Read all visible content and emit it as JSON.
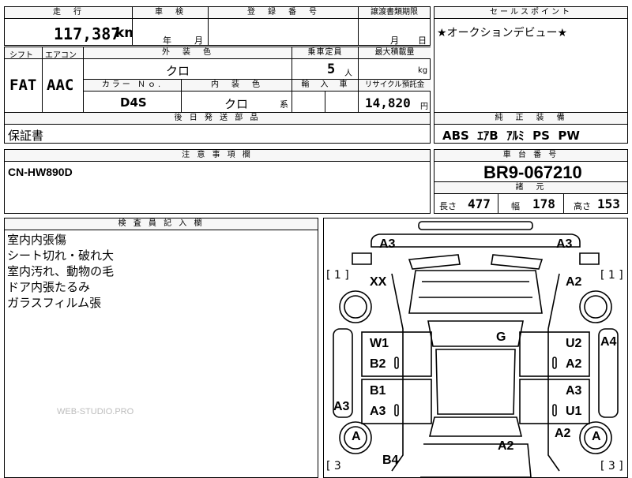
{
  "top": {
    "mileage_header": "走　行",
    "mileage_value": "117,387",
    "mileage_unit": "km",
    "inspection_header": "車　検",
    "inspection_year": "年",
    "inspection_month": "月",
    "registration_header": "登　録　番　号",
    "transfer_header": "譲渡書類期限",
    "transfer_month": "月",
    "transfer_day": "日",
    "selling_header": "セールスポイント",
    "selling_text": "★オークションデビュー★"
  },
  "specs": {
    "shift_header": "シフト",
    "shift_value": "FAT",
    "aircon_header": "エアコン",
    "aircon_value": "AAC",
    "exterior_header": "外　装　色",
    "exterior_value": "クロ",
    "color_no_header": "カラー Ｎｏ.",
    "color_no_value": "D4S",
    "interior_header": "内　装　色",
    "interior_value": "クロ",
    "interior_suffix": "系",
    "capacity_header": "乗車定員",
    "capacity_value": "5",
    "capacity_unit": "人",
    "load_header": "最大積載量",
    "load_unit": "kg",
    "import_header": "輸　入　車",
    "recycle_header": "リサイクル預託金",
    "recycle_value": "14,820",
    "recycle_unit": "円"
  },
  "equipment": {
    "header": "純　正　装　備",
    "value": "ABS  ｴｱB  ｱﾙﾐ  PS  PW"
  },
  "later_parts": {
    "header": "後 日 発 送 部 品",
    "value": "保証書"
  },
  "notes": {
    "header": "注 意 事 項 欄",
    "value": "CN-HW890D"
  },
  "chassis": {
    "header": "車 台 番 号",
    "value": "BR9-067210"
  },
  "dimensions": {
    "header": "諸　元",
    "length_label": "長さ",
    "length_value": "477",
    "width_label": "幅",
    "width_value": "178",
    "height_label": "高さ",
    "height_value": "153"
  },
  "inspector": {
    "header": "検 査 員 記 入 欄",
    "lines": [
      "室内内張傷",
      "シート切れ・破れ大",
      "室内汚れ、動物の毛",
      "ドア内張たるみ",
      "ガラスフィルム張"
    ]
  },
  "watermark": "WEB-STUDIO.PRO",
  "diagram": {
    "bracket_left_top": "[ 1 ]",
    "bracket_right_top": "[ 1 ]",
    "bracket_left_bottom": "[ 3",
    "bracket_right_bottom": "[ 3 ]",
    "marks": {
      "front_left_corner": "A3",
      "front_right_corner": "A3",
      "front_left": "XX",
      "front_right_fender": "A2",
      "roof": "G",
      "door_fl_1": "W1",
      "door_fl_2": "B2",
      "door_fr_1": "U2",
      "door_fr_2": "A2",
      "right_step": "A4",
      "door_rl_1": "B1",
      "door_rl_2": "A3",
      "door_rr_1": "A3",
      "door_rr_2": "U1",
      "left_step": "A3",
      "wheel_rl": "A",
      "wheel_rr": "A",
      "rear_right_fender": "A2",
      "trunk": "A2",
      "rear_left": "B4"
    }
  }
}
